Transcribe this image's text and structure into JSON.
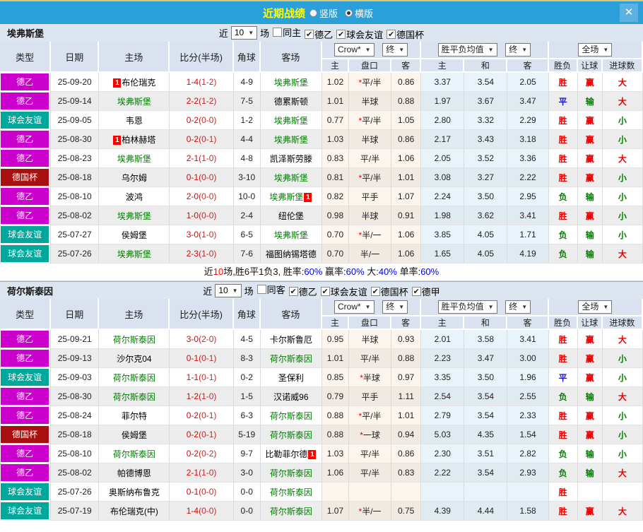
{
  "titlebar": {
    "title": "近期战绩",
    "vertical_label": "竖版",
    "vertical_selected": false,
    "horizontal_label": "横版",
    "horizontal_selected": true,
    "close_glyph": "✕"
  },
  "table": {
    "near_label": "近",
    "games_label": "场",
    "columns": {
      "type": "类型",
      "date": "日期",
      "home": "主场",
      "score": "比分(半场)",
      "corner": "角球",
      "away": "客场",
      "odds_home": "主",
      "handicap": "盘口",
      "odds_away": "客",
      "avg_home": "主",
      "avg_draw": "和",
      "avg_away": "客",
      "wdl": "胜负",
      "handicap_result": "让球",
      "goals": "进球数"
    },
    "dropdowns": {
      "company": "Crow*",
      "final1": "终",
      "avg": "胜平负均值",
      "final2": "终",
      "scope": "全场"
    }
  },
  "type_colors": {
    "德乙": "#cc00cc",
    "球会友谊": "#00a79b",
    "德国杯": "#a81010",
    "德甲": "#cc00cc"
  },
  "result_colors": {
    "胜": "#e60000",
    "平": "#1414e6",
    "负": "#008000",
    "赢": "#e60000",
    "输": "#008000",
    "大": "#e60000",
    "小": "#008000"
  },
  "sections": [
    {
      "team": "埃弗斯堡",
      "count": "10",
      "filters": [
        {
          "label": "同主",
          "checked": false
        },
        {
          "label": "德乙",
          "checked": true
        },
        {
          "label": "球会友谊",
          "checked": true
        },
        {
          "label": "德国杯",
          "checked": true
        }
      ],
      "rows": [
        {
          "type": "德乙",
          "date": "25-09-20",
          "home": "布伦瑞克",
          "home_self": false,
          "home_badge": true,
          "score": "1-4",
          "half": "(1-2)",
          "corner": "4-9",
          "away": "埃弗斯堡",
          "away_self": true,
          "away_badge": false,
          "o1": "1.02",
          "star": true,
          "hc": "平/半",
          "o2": "0.86",
          "a1": "3.37",
          "a2": "3.54",
          "a3": "2.05",
          "r1": "胜",
          "r2": "赢",
          "r3": "大"
        },
        {
          "type": "德乙",
          "date": "25-09-14",
          "home": "埃弗斯堡",
          "home_self": true,
          "home_badge": false,
          "score": "2-2",
          "half": "(1-2)",
          "corner": "7-5",
          "away": "德累斯顿",
          "away_self": false,
          "away_badge": false,
          "o1": "1.01",
          "star": false,
          "hc": "半球",
          "o2": "0.88",
          "a1": "1.97",
          "a2": "3.67",
          "a3": "3.47",
          "r1": "平",
          "r2": "输",
          "r3": "大"
        },
        {
          "type": "球会友谊",
          "date": "25-09-05",
          "home": "韦恩",
          "home_self": false,
          "home_badge": false,
          "score": "0-2",
          "half": "(0-0)",
          "corner": "1-2",
          "away": "埃弗斯堡",
          "away_self": true,
          "away_badge": false,
          "o1": "0.77",
          "star": true,
          "hc": "平/半",
          "o2": "1.05",
          "a1": "2.80",
          "a2": "3.32",
          "a3": "2.29",
          "r1": "胜",
          "r2": "赢",
          "r3": "小"
        },
        {
          "type": "德乙",
          "date": "25-08-30",
          "home": "柏林赫塔",
          "home_self": false,
          "home_badge": true,
          "score": "0-2",
          "half": "(0-1)",
          "corner": "4-4",
          "away": "埃弗斯堡",
          "away_self": true,
          "away_badge": false,
          "o1": "1.03",
          "star": false,
          "hc": "半球",
          "o2": "0.86",
          "a1": "2.17",
          "a2": "3.43",
          "a3": "3.18",
          "r1": "胜",
          "r2": "赢",
          "r3": "小"
        },
        {
          "type": "德乙",
          "date": "25-08-23",
          "home": "埃弗斯堡",
          "home_self": true,
          "home_badge": false,
          "score": "2-1",
          "half": "(1-0)",
          "corner": "4-8",
          "away": "凯泽斯劳滕",
          "away_self": false,
          "away_badge": false,
          "o1": "0.83",
          "star": false,
          "hc": "平/半",
          "o2": "1.06",
          "a1": "2.05",
          "a2": "3.52",
          "a3": "3.36",
          "r1": "胜",
          "r2": "赢",
          "r3": "大"
        },
        {
          "type": "德国杯",
          "date": "25-08-18",
          "home": "乌尔姆",
          "home_self": false,
          "home_badge": false,
          "score": "0-1",
          "half": "(0-0)",
          "corner": "3-10",
          "away": "埃弗斯堡",
          "away_self": true,
          "away_badge": false,
          "o1": "0.81",
          "star": true,
          "hc": "平/半",
          "o2": "1.01",
          "a1": "3.08",
          "a2": "3.27",
          "a3": "2.22",
          "r1": "胜",
          "r2": "赢",
          "r3": "小"
        },
        {
          "type": "德乙",
          "date": "25-08-10",
          "home": "波鸿",
          "home_self": false,
          "home_badge": false,
          "score": "2-0",
          "half": "(0-0)",
          "corner": "10-0",
          "away": "埃弗斯堡",
          "away_self": true,
          "away_badge": true,
          "o1": "0.82",
          "star": false,
          "hc": "平手",
          "o2": "1.07",
          "a1": "2.24",
          "a2": "3.50",
          "a3": "2.95",
          "r1": "负",
          "r2": "输",
          "r3": "小"
        },
        {
          "type": "德乙",
          "date": "25-08-02",
          "home": "埃弗斯堡",
          "home_self": true,
          "home_badge": false,
          "score": "1-0",
          "half": "(0-0)",
          "corner": "2-4",
          "away": "纽伦堡",
          "away_self": false,
          "away_badge": false,
          "o1": "0.98",
          "star": false,
          "hc": "半球",
          "o2": "0.91",
          "a1": "1.98",
          "a2": "3.62",
          "a3": "3.41",
          "r1": "胜",
          "r2": "赢",
          "r3": "小"
        },
        {
          "type": "球会友谊",
          "date": "25-07-27",
          "home": "侯姆堡",
          "home_self": false,
          "home_badge": false,
          "score": "3-0",
          "half": "(1-0)",
          "corner": "6-5",
          "away": "埃弗斯堡",
          "away_self": true,
          "away_badge": false,
          "o1": "0.70",
          "star": true,
          "hc": "半/一",
          "o2": "1.06",
          "a1": "3.85",
          "a2": "4.05",
          "a3": "1.71",
          "r1": "负",
          "r2": "输",
          "r3": "小"
        },
        {
          "type": "球会友谊",
          "date": "25-07-26",
          "home": "埃弗斯堡",
          "home_self": true,
          "home_badge": false,
          "score": "2-3",
          "half": "(1-0)",
          "corner": "7-6",
          "away": "福图纳锡塔德",
          "away_self": false,
          "away_badge": false,
          "o1": "0.70",
          "star": false,
          "hc": "半/一",
          "o2": "1.06",
          "a1": "1.65",
          "a2": "4.05",
          "a3": "4.19",
          "r1": "负",
          "r2": "输",
          "r3": "大"
        }
      ],
      "summary": [
        {
          "t": "近",
          "c": "#111"
        },
        {
          "t": "10",
          "c": "#ff0000"
        },
        {
          "t": "场,胜6平1负3, 胜率:",
          "c": "#111"
        },
        {
          "t": "60%",
          "c": "#0000ee"
        },
        {
          "t": " 赢率:",
          "c": "#111"
        },
        {
          "t": "60%",
          "c": "#0000ee"
        },
        {
          "t": " 大:",
          "c": "#111"
        },
        {
          "t": "40%",
          "c": "#0000ee"
        },
        {
          "t": " 单率:",
          "c": "#111"
        },
        {
          "t": "60%",
          "c": "#0000ee"
        }
      ]
    },
    {
      "team": "荷尔斯泰因",
      "count": "10",
      "filters": [
        {
          "label": "同客",
          "checked": false
        },
        {
          "label": "德乙",
          "checked": true
        },
        {
          "label": "球会友谊",
          "checked": true
        },
        {
          "label": "德国杯",
          "checked": true
        },
        {
          "label": "德甲",
          "checked": true
        }
      ],
      "rows": [
        {
          "type": "德乙",
          "date": "25-09-21",
          "home": "荷尔斯泰因",
          "home_self": true,
          "home_badge": false,
          "score": "3-0",
          "half": "(2-0)",
          "corner": "4-5",
          "away": "卡尔斯鲁厄",
          "away_self": false,
          "away_badge": false,
          "o1": "0.95",
          "star": false,
          "hc": "半球",
          "o2": "0.93",
          "a1": "2.01",
          "a2": "3.58",
          "a3": "3.41",
          "r1": "胜",
          "r2": "赢",
          "r3": "大"
        },
        {
          "type": "德乙",
          "date": "25-09-13",
          "home": "沙尔克04",
          "home_self": false,
          "home_badge": false,
          "score": "0-1",
          "half": "(0-1)",
          "corner": "8-3",
          "away": "荷尔斯泰因",
          "away_self": true,
          "away_badge": false,
          "o1": "1.01",
          "star": false,
          "hc": "平/半",
          "o2": "0.88",
          "a1": "2.23",
          "a2": "3.47",
          "a3": "3.00",
          "r1": "胜",
          "r2": "赢",
          "r3": "小"
        },
        {
          "type": "球会友谊",
          "date": "25-09-03",
          "home": "荷尔斯泰因",
          "home_self": true,
          "home_badge": false,
          "score": "1-1",
          "half": "(0-1)",
          "corner": "0-2",
          "away": "圣保利",
          "away_self": false,
          "away_badge": false,
          "o1": "0.85",
          "star": true,
          "hc": "半球",
          "o2": "0.97",
          "a1": "3.35",
          "a2": "3.50",
          "a3": "1.96",
          "r1": "平",
          "r2": "赢",
          "r3": "小"
        },
        {
          "type": "德乙",
          "date": "25-08-30",
          "home": "荷尔斯泰因",
          "home_self": true,
          "home_badge": false,
          "score": "1-2",
          "half": "(1-0)",
          "corner": "1-5",
          "away": "汉诺威96",
          "away_self": false,
          "away_badge": false,
          "o1": "0.79",
          "star": false,
          "hc": "平手",
          "o2": "1.11",
          "a1": "2.54",
          "a2": "3.54",
          "a3": "2.55",
          "r1": "负",
          "r2": "输",
          "r3": "大"
        },
        {
          "type": "德乙",
          "date": "25-08-24",
          "home": "菲尔特",
          "home_self": false,
          "home_badge": false,
          "score": "0-2",
          "half": "(0-1)",
          "corner": "6-3",
          "away": "荷尔斯泰因",
          "away_self": true,
          "away_badge": false,
          "o1": "0.88",
          "star": true,
          "hc": "平/半",
          "o2": "1.01",
          "a1": "2.79",
          "a2": "3.54",
          "a3": "2.33",
          "r1": "胜",
          "r2": "赢",
          "r3": "小"
        },
        {
          "type": "德国杯",
          "date": "25-08-18",
          "home": "侯姆堡",
          "home_self": false,
          "home_badge": false,
          "score": "0-2",
          "half": "(0-1)",
          "corner": "5-19",
          "away": "荷尔斯泰因",
          "away_self": true,
          "away_badge": false,
          "o1": "0.88",
          "star": true,
          "hc": "一球",
          "o2": "0.94",
          "a1": "5.03",
          "a2": "4.35",
          "a3": "1.54",
          "r1": "胜",
          "r2": "赢",
          "r3": "小"
        },
        {
          "type": "德乙",
          "date": "25-08-10",
          "home": "荷尔斯泰因",
          "home_self": true,
          "home_badge": false,
          "score": "0-2",
          "half": "(0-2)",
          "corner": "9-7",
          "away": "比勒菲尔德",
          "away_self": false,
          "away_badge": true,
          "o1": "1.03",
          "star": false,
          "hc": "平/半",
          "o2": "0.86",
          "a1": "2.30",
          "a2": "3.51",
          "a3": "2.82",
          "r1": "负",
          "r2": "输",
          "r3": "小"
        },
        {
          "type": "德乙",
          "date": "25-08-02",
          "home": "帕德博恩",
          "home_self": false,
          "home_badge": false,
          "score": "2-1",
          "half": "(1-0)",
          "corner": "3-0",
          "away": "荷尔斯泰因",
          "away_self": true,
          "away_badge": false,
          "o1": "1.06",
          "star": false,
          "hc": "平/半",
          "o2": "0.83",
          "a1": "2.22",
          "a2": "3.54",
          "a3": "2.93",
          "r1": "负",
          "r2": "输",
          "r3": "大"
        },
        {
          "type": "球会友谊",
          "date": "25-07-26",
          "home": "奥斯纳布鲁克",
          "home_self": false,
          "home_badge": false,
          "score": "0-1",
          "half": "(0-0)",
          "corner": "0-0",
          "away": "荷尔斯泰因",
          "away_self": true,
          "away_badge": false,
          "o1": "",
          "star": false,
          "hc": "",
          "o2": "",
          "a1": "",
          "a2": "",
          "a3": "",
          "r1": "胜",
          "r2": "",
          "r3": ""
        },
        {
          "type": "球会友谊",
          "date": "25-07-19",
          "home": "布伦瑞克(中)",
          "home_self": false,
          "home_badge": false,
          "score": "1-4",
          "half": "(0-0)",
          "corner": "0-0",
          "away": "荷尔斯泰因",
          "away_self": true,
          "away_badge": false,
          "o1": "1.07",
          "star": true,
          "hc": "半/一",
          "o2": "0.75",
          "a1": "4.39",
          "a2": "4.44",
          "a3": "1.58",
          "r1": "胜",
          "r2": "赢",
          "r3": "大"
        }
      ],
      "summary": null
    }
  ]
}
